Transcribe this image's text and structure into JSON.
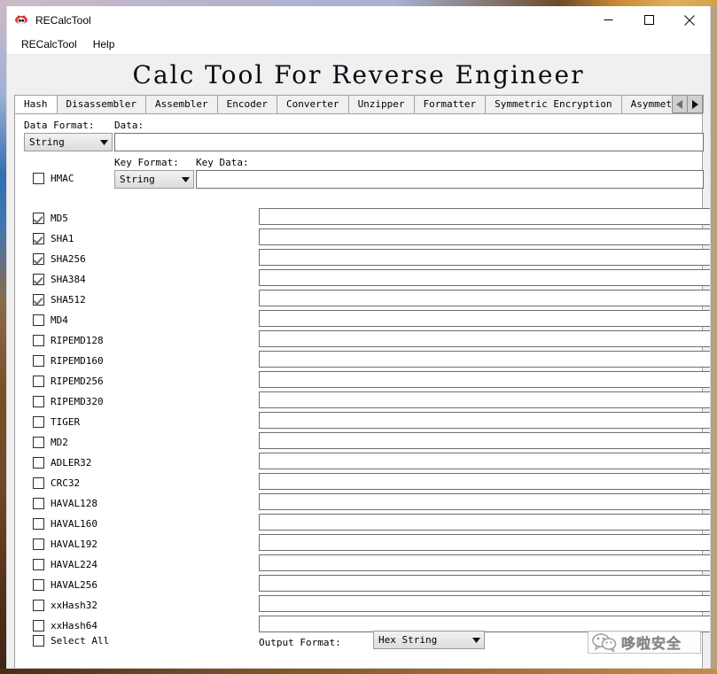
{
  "window": {
    "title": "RECalcTool",
    "icon": "app-icon",
    "controls": {
      "minimize": "minimize-icon",
      "maximize": "maximize-icon",
      "close": "close-icon"
    }
  },
  "menubar": {
    "items": [
      {
        "label": "RECalcTool"
      },
      {
        "label": "Help"
      }
    ]
  },
  "heading": "Calc Tool For Reverse Engineer",
  "tabs": {
    "items": [
      {
        "label": "Hash",
        "selected": true
      },
      {
        "label": "Disassembler",
        "selected": false
      },
      {
        "label": "Assembler",
        "selected": false
      },
      {
        "label": "Encoder",
        "selected": false
      },
      {
        "label": "Converter",
        "selected": false
      },
      {
        "label": "Unzipper",
        "selected": false
      },
      {
        "label": "Formatter",
        "selected": false
      },
      {
        "label": "Symmetric Encryption",
        "selected": false
      },
      {
        "label": "Asymmetric Enc",
        "selected": false
      }
    ],
    "scroll_left": "◀",
    "scroll_right": "▶"
  },
  "form": {
    "data_format_label": "Data Format:",
    "data_format_value": "String",
    "data_label": "Data:",
    "data_value": "",
    "key_format_label": "Key Format:",
    "key_format_value": "String",
    "key_data_label": "Key Data:",
    "key_data_value": "",
    "hmac_label": "HMAC",
    "hmac_checked": false
  },
  "algorithms": [
    {
      "label": "MD5",
      "checked": true,
      "result": ""
    },
    {
      "label": "SHA1",
      "checked": true,
      "result": ""
    },
    {
      "label": "SHA256",
      "checked": true,
      "result": ""
    },
    {
      "label": "SHA384",
      "checked": true,
      "result": ""
    },
    {
      "label": "SHA512",
      "checked": true,
      "result": ""
    },
    {
      "label": "MD4",
      "checked": false,
      "result": ""
    },
    {
      "label": "RIPEMD128",
      "checked": false,
      "result": ""
    },
    {
      "label": "RIPEMD160",
      "checked": false,
      "result": ""
    },
    {
      "label": "RIPEMD256",
      "checked": false,
      "result": ""
    },
    {
      "label": "RIPEMD320",
      "checked": false,
      "result": ""
    },
    {
      "label": "TIGER",
      "checked": false,
      "result": ""
    },
    {
      "label": "MD2",
      "checked": false,
      "result": ""
    },
    {
      "label": "ADLER32",
      "checked": false,
      "result": ""
    },
    {
      "label": "CRC32",
      "checked": false,
      "result": ""
    },
    {
      "label": "HAVAL128",
      "checked": false,
      "result": ""
    },
    {
      "label": "HAVAL160",
      "checked": false,
      "result": ""
    },
    {
      "label": "HAVAL192",
      "checked": false,
      "result": ""
    },
    {
      "label": "HAVAL224",
      "checked": false,
      "result": ""
    },
    {
      "label": "HAVAL256",
      "checked": false,
      "result": ""
    },
    {
      "label": "xxHash32",
      "checked": false,
      "result": ""
    },
    {
      "label": "xxHash64",
      "checked": false,
      "result": ""
    }
  ],
  "select_all": {
    "label": "Select All",
    "checked": false
  },
  "output": {
    "label": "Output Format:",
    "value": "Hex String"
  },
  "watermark": {
    "text": "哆啦安全",
    "logo": "wechat-icon"
  },
  "colors": {
    "window_bg": "#f0f0f0",
    "panel_bg": "#ffffff",
    "border": "#a0a0a0",
    "input_border": "#6e6e6e",
    "text": "#000000",
    "checkmark": "#6f6f6f"
  }
}
